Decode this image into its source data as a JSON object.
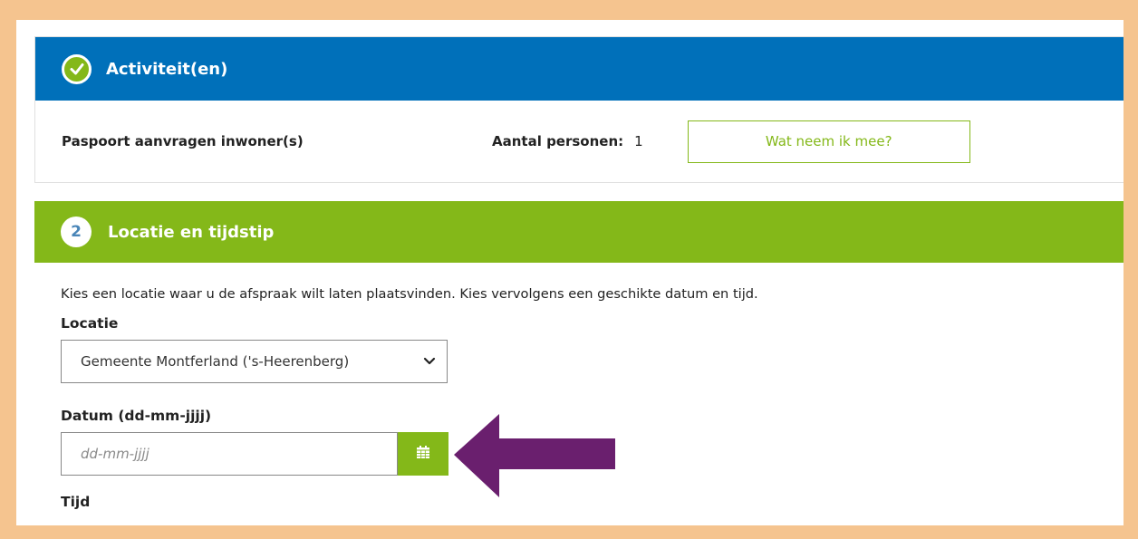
{
  "activities": {
    "header": "Activiteit(en)",
    "activity_name": "Paspoort aanvragen inwoner(s)",
    "persons_label": "Aantal personen:",
    "persons_value": "1",
    "what_button": "Wat neem ik mee?"
  },
  "location_section": {
    "step_number": "2",
    "header": "Locatie en tijdstip",
    "intro": "Kies een locatie waar u de afspraak wilt laten plaatsvinden. Kies vervolgens een geschikte datum en tijd.",
    "location_label": "Locatie",
    "location_value": "Gemeente Montferland ('s-Heerenberg)",
    "date_label": "Datum (dd-mm-jjjj)",
    "date_placeholder": "dd-mm-jjjj",
    "time_label": "Tijd"
  },
  "colors": {
    "page_border": "#f5c48f",
    "blue_header": "#0070ba",
    "green_accent": "#84b819",
    "arrow": "#6a1f6e"
  },
  "icons": {
    "check": "check-circle-icon",
    "calendar": "calendar-icon",
    "chevron": "chevron-down-icon",
    "arrow": "arrow-left-icon"
  }
}
